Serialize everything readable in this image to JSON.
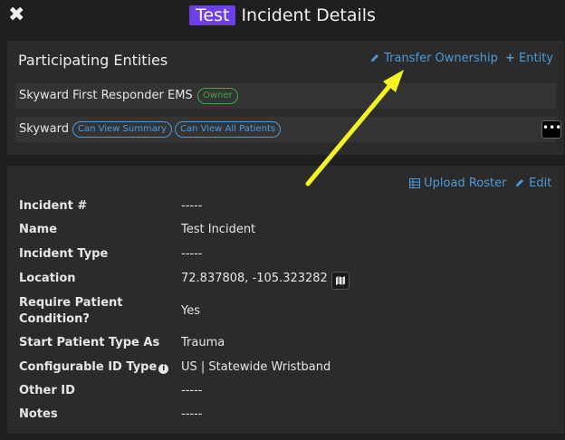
{
  "header": {
    "badge": "Test",
    "title": "Incident Details",
    "close_icon": "close-icon"
  },
  "entities_panel": {
    "title": "Participating Entities",
    "transfer_label": "Transfer Ownership",
    "add_entity_label": "Entity",
    "entities": [
      {
        "name": "Skyward First Responder EMS",
        "badges": [
          "Owner"
        ]
      },
      {
        "name": "Skyward",
        "badges": [
          "Can View Summary",
          "Can View All Patients"
        ],
        "menu": "•••"
      }
    ]
  },
  "details_panel": {
    "upload_label": "Upload Roster",
    "edit_label": "Edit",
    "fields": [
      {
        "label": "Incident #",
        "value": "-----"
      },
      {
        "label": "Name",
        "value": "Test Incident"
      },
      {
        "label": "Incident Type",
        "value": "-----"
      },
      {
        "label": "Location",
        "value": "72.837808, -105.323282"
      },
      {
        "label": "Require Patient",
        "label2": "Condition?",
        "value": "Yes"
      },
      {
        "label": "Start Patient Type As",
        "value": "Trauma"
      },
      {
        "label": "Configurable ID Type",
        "value": "US | Statewide Wristband"
      },
      {
        "label": "Other ID",
        "value": "-----"
      },
      {
        "label": "Notes",
        "value": "-----"
      }
    ]
  },
  "colors": {
    "accent": "#4e9bdc",
    "badge_purple": "#6d3fe6",
    "owner_green": "#3ea84b",
    "annotation_arrow": "#f4f424"
  }
}
